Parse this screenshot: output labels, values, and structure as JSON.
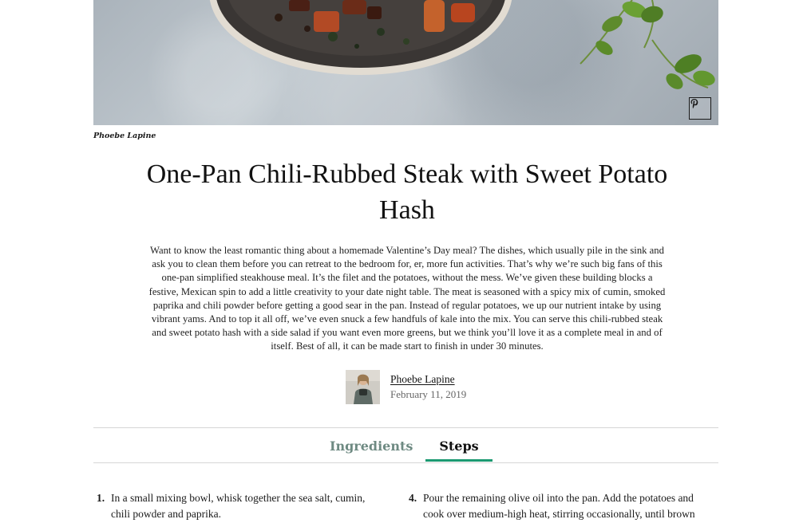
{
  "hero": {
    "photo_credit": "Phoebe Lapine",
    "pin_icon": "pinterest-icon"
  },
  "recipe": {
    "title": "One-Pan Chili-Rubbed Steak with Sweet Potato Hash",
    "intro": "Want to know the least romantic thing about a homemade Valentine’s Day meal? The dishes, which usually pile in the sink and ask you to clean them before you can retreat to the bedroom for, er, more fun activities. That’s why we’re such big fans of this one-pan simplified steakhouse meal. It’s the filet and the potatoes, without the mess. We’ve given these building blocks a festive, Mexican spin to add a little creativity to your date night table. The meat is seasoned with a spicy mix of cumin, smoked paprika and chili powder before getting a good sear in the pan. Instead of regular potatoes, we up our nutrient intake by using vibrant yams. And to top it all off, we’ve even snuck a few handfuls of kale into the mix. You can serve this chili-rubbed steak and sweet potato hash with a side salad if you want even more greens, but we think you’ll love it as a complete meal in and of itself. Best of all, it can be made start to finish in under 30 minutes."
  },
  "author": {
    "name": "Phoebe Lapine",
    "date": "February 11, 2019"
  },
  "tabs": {
    "ingredients": "Ingredients",
    "steps": "Steps",
    "active": "Steps",
    "accent_color": "#1c9a72"
  },
  "steps": [
    {
      "num": "1.",
      "text": "In a small mixing bowl, whisk together the sea salt, cumin, chili powder and paprika."
    },
    {
      "num": "4.",
      "text": "Pour the remaining olive oil into the pan. Add the potatoes and cook over medium-high heat, stirring occasionally, until brown"
    }
  ]
}
